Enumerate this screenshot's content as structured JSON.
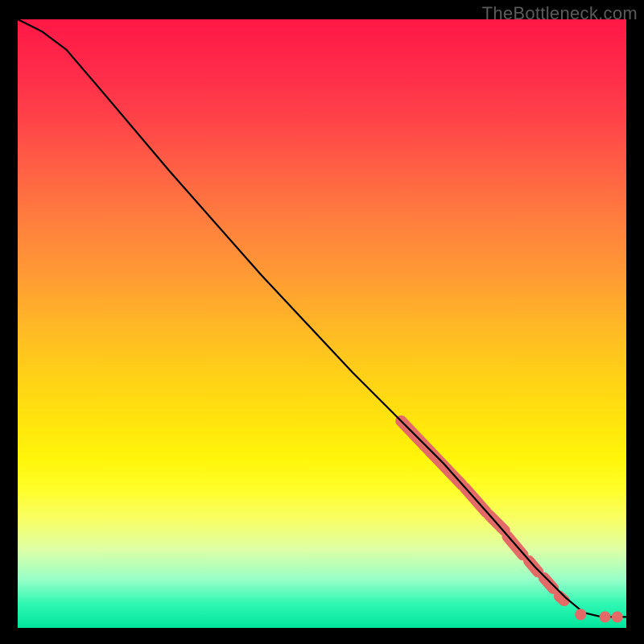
{
  "watermark": "TheBottleneck.com",
  "chart_data": {
    "type": "line",
    "title": "",
    "xlabel": "",
    "ylabel": "",
    "xlim": [
      0,
      100
    ],
    "ylim": [
      0,
      100
    ],
    "gradient_colors": {
      "top": "#ff1846",
      "middle": "#ffe40d",
      "bottom": "#00e59b"
    },
    "line": {
      "color": "#000000",
      "points": [
        {
          "x": 0,
          "y": 100
        },
        {
          "x": 4,
          "y": 98
        },
        {
          "x": 8,
          "y": 95
        },
        {
          "x": 14,
          "y": 88
        },
        {
          "x": 25,
          "y": 75
        },
        {
          "x": 40,
          "y": 58
        },
        {
          "x": 55,
          "y": 42
        },
        {
          "x": 63,
          "y": 34
        },
        {
          "x": 70,
          "y": 27
        },
        {
          "x": 78,
          "y": 18
        },
        {
          "x": 85,
          "y": 10
        },
        {
          "x": 90,
          "y": 5
        },
        {
          "x": 93,
          "y": 2.5
        },
        {
          "x": 96,
          "y": 1.8
        },
        {
          "x": 100,
          "y": 1.8
        }
      ]
    },
    "marker_segments": {
      "color": "#e36a67",
      "stroke_width": 14,
      "segments": [
        {
          "x1": 63,
          "y1": 34,
          "x2": 73,
          "y2": 23.5
        },
        {
          "x1": 73.5,
          "y1": 23,
          "x2": 77,
          "y2": 19
        },
        {
          "x1": 77.5,
          "y1": 18.5,
          "x2": 80,
          "y2": 16
        },
        {
          "x1": 80.5,
          "y1": 15,
          "x2": 83,
          "y2": 12
        },
        {
          "x1": 84,
          "y1": 11,
          "x2": 85.5,
          "y2": 9.2
        },
        {
          "x1": 86.5,
          "y1": 8.2,
          "x2": 88,
          "y2": 6.5
        },
        {
          "x1": 89,
          "y1": 5.2,
          "x2": 89.8,
          "y2": 4.5
        }
      ]
    },
    "marker_dots": {
      "color": "#e36a67",
      "radius": 7,
      "points": [
        {
          "x": 92.5,
          "y": 2.2
        },
        {
          "x": 96.5,
          "y": 1.8
        },
        {
          "x": 98.5,
          "y": 1.8
        }
      ]
    }
  }
}
